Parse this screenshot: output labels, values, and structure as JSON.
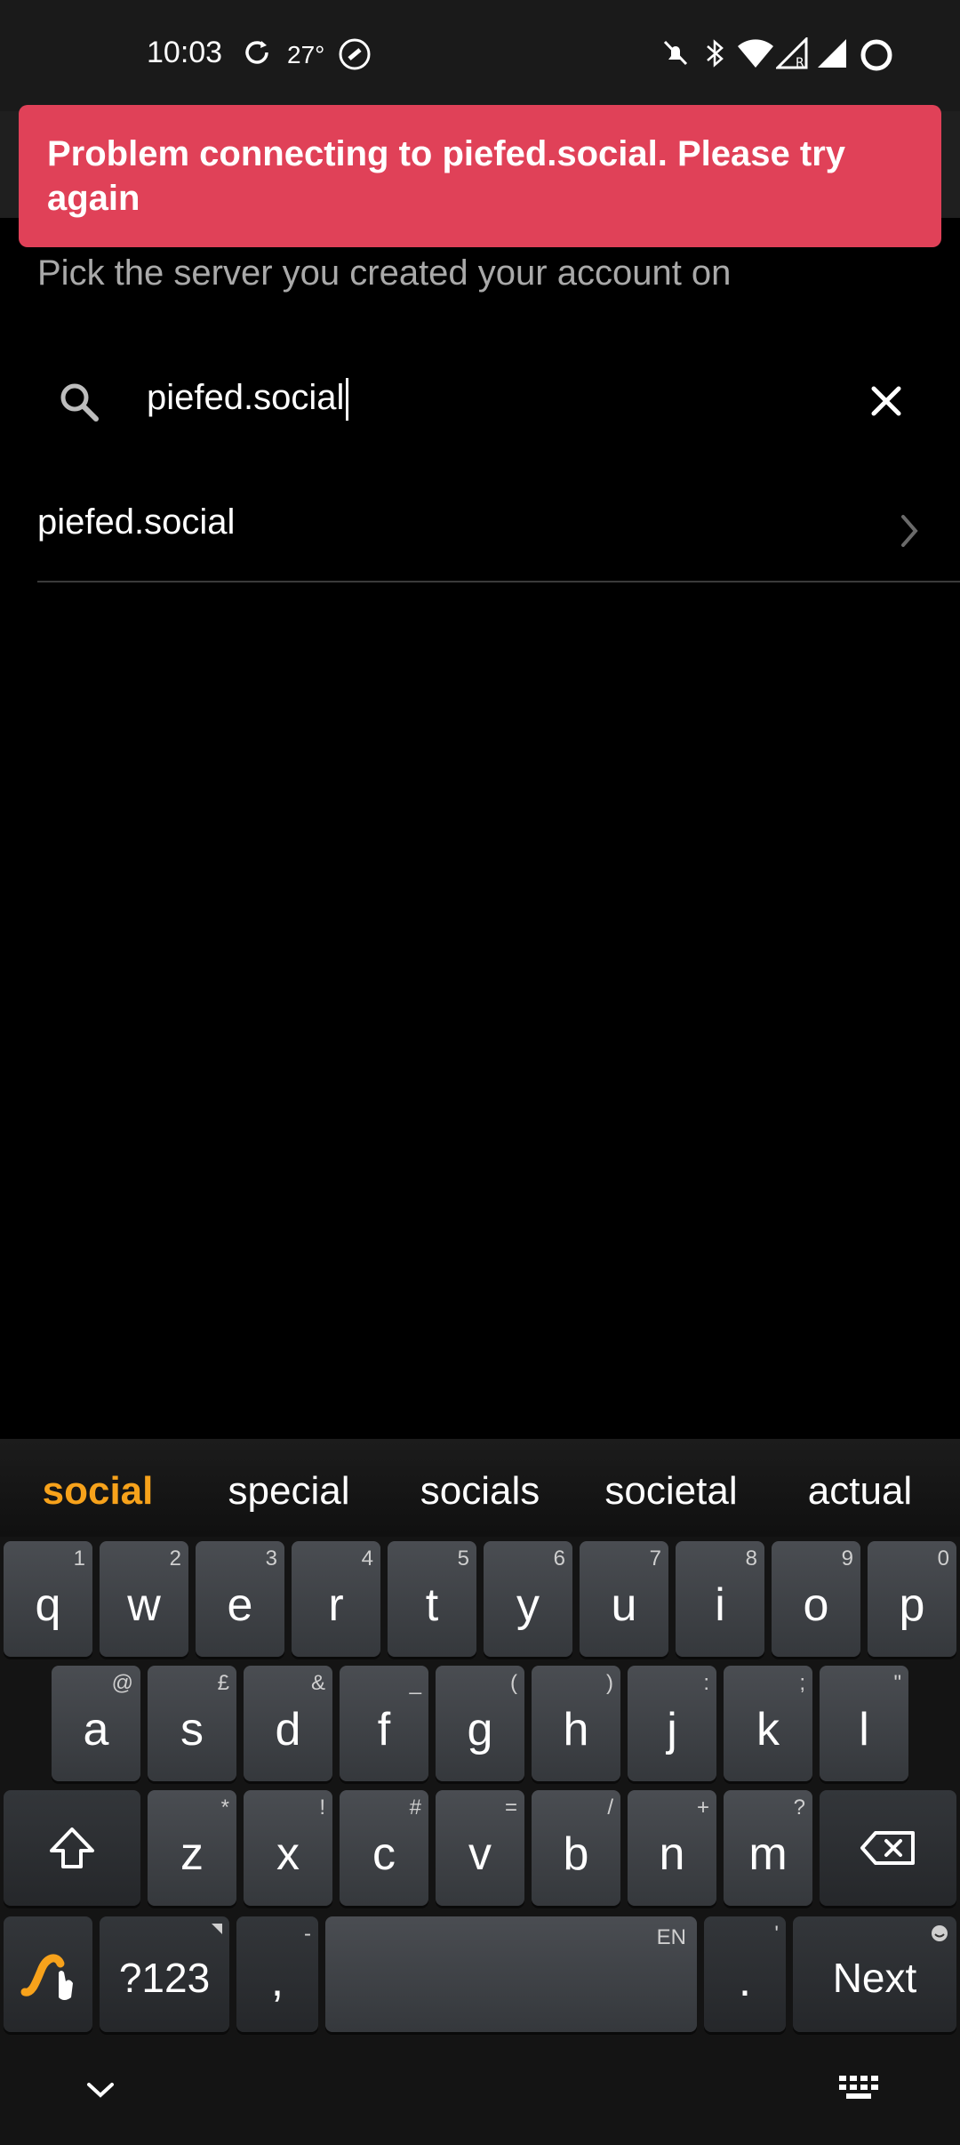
{
  "status_bar": {
    "time": "10:03",
    "temperature": "27°"
  },
  "error": {
    "message": "Problem connecting to piefed.social. Please try again"
  },
  "page": {
    "subtitle": "Pick the server you created your account on"
  },
  "search": {
    "value": "piefed.social"
  },
  "results": [
    {
      "label": "piefed.social"
    }
  ],
  "keyboard": {
    "suggestions": [
      "social",
      "special",
      "socials",
      "societal",
      "actual"
    ],
    "row1": [
      {
        "k": "q",
        "h": "1"
      },
      {
        "k": "w",
        "h": "2"
      },
      {
        "k": "e",
        "h": "3"
      },
      {
        "k": "r",
        "h": "4"
      },
      {
        "k": "t",
        "h": "5"
      },
      {
        "k": "y",
        "h": "6"
      },
      {
        "k": "u",
        "h": "7"
      },
      {
        "k": "i",
        "h": "8"
      },
      {
        "k": "o",
        "h": "9"
      },
      {
        "k": "p",
        "h": "0"
      }
    ],
    "row2": [
      {
        "k": "a",
        "h": "@"
      },
      {
        "k": "s",
        "h": "£"
      },
      {
        "k": "d",
        "h": "&"
      },
      {
        "k": "f",
        "h": "_"
      },
      {
        "k": "g",
        "h": "("
      },
      {
        "k": "h",
        "h": ")"
      },
      {
        "k": "j",
        "h": ":"
      },
      {
        "k": "k",
        "h": ";"
      },
      {
        "k": "l",
        "h": "\""
      }
    ],
    "row3": [
      {
        "k": "z",
        "h": "*"
      },
      {
        "k": "x",
        "h": "!"
      },
      {
        "k": "c",
        "h": "#"
      },
      {
        "k": "v",
        "h": "="
      },
      {
        "k": "b",
        "h": "/"
      },
      {
        "k": "n",
        "h": "+"
      },
      {
        "k": "m",
        "h": "?"
      }
    ],
    "symbols_label": "?123",
    "comma_label": ",",
    "comma_hint": "-",
    "space_hint": "EN",
    "period_label": ".",
    "period_hint": "'",
    "next_label": "Next"
  }
}
